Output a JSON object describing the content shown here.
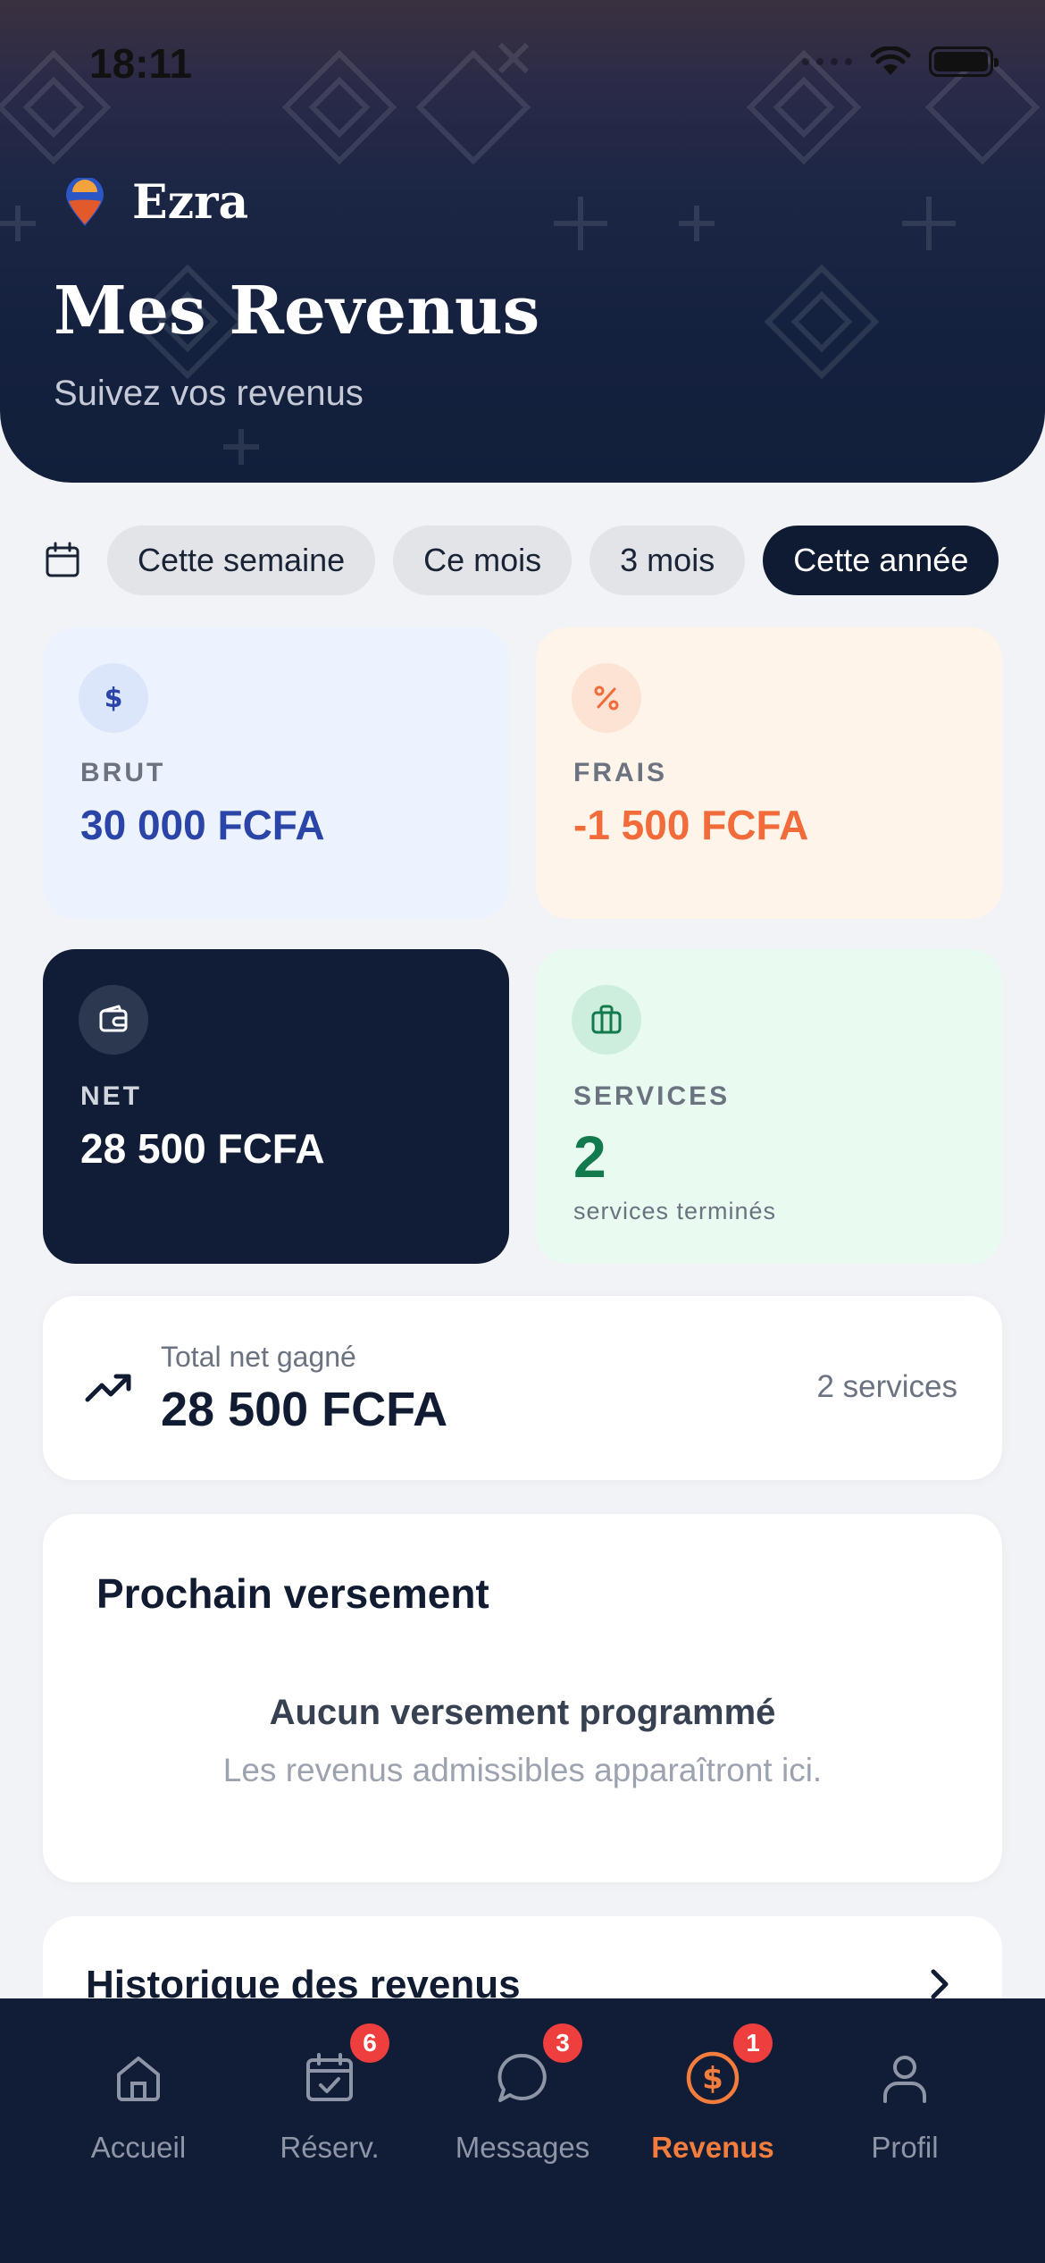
{
  "status_bar": {
    "time": "18:11"
  },
  "brand": {
    "name": "Ezra"
  },
  "header": {
    "title": "Mes Revenus",
    "subtitle": "Suivez vos revenus"
  },
  "filters": [
    {
      "label": "Cette semaine",
      "active": false
    },
    {
      "label": "Ce mois",
      "active": false
    },
    {
      "label": "3 mois",
      "active": false
    },
    {
      "label": "Cette année",
      "active": true
    }
  ],
  "stats": {
    "brut": {
      "label": "BRUT",
      "value": "30 000 FCFA",
      "icon": "dollar-icon",
      "color": "#2a44a8"
    },
    "frais": {
      "label": "FRAIS",
      "value": "-1 500 FCFA",
      "icon": "percent-icon",
      "color": "#f26b3a"
    },
    "net": {
      "label": "NET",
      "value": "28 500 FCFA",
      "icon": "wallet-icon",
      "color": "#ffffff"
    },
    "services": {
      "label": "SERVICES",
      "value": "2",
      "caption": "services terminés",
      "icon": "briefcase-icon",
      "color": "#137a4d"
    }
  },
  "total": {
    "label": "Total net gagné",
    "value": "28 500 FCFA",
    "count": "2 services",
    "icon": "trending-up-icon"
  },
  "payout": {
    "title": "Prochain versement",
    "empty_title": "Aucun versement programmé",
    "empty_text": "Les revenus admissibles apparaîtront ici."
  },
  "history": {
    "title": "Historique des revenus"
  },
  "tabbar": [
    {
      "label": "Accueil",
      "icon": "home-icon",
      "badge": "",
      "active": false
    },
    {
      "label": "Réserv.",
      "icon": "calendar-check-icon",
      "badge": "6",
      "active": false
    },
    {
      "label": "Messages",
      "icon": "chat-icon",
      "badge": "3",
      "active": false
    },
    {
      "label": "Revenus",
      "icon": "dollar-circle-icon",
      "badge": "1",
      "active": true
    },
    {
      "label": "Profil",
      "icon": "user-icon",
      "badge": "",
      "active": false
    }
  ],
  "colors": {
    "navy": "#111d36",
    "accent": "#f47c3c",
    "badge": "#ef3e3e"
  }
}
